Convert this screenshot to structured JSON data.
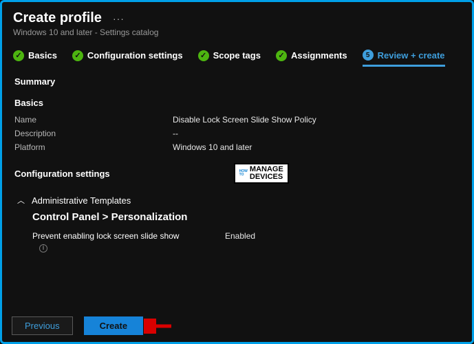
{
  "header": {
    "title": "Create profile",
    "subtitle": "Windows 10 and later - Settings catalog"
  },
  "steps": {
    "s1": "Basics",
    "s2": "Configuration settings",
    "s3": "Scope tags",
    "s4": "Assignments",
    "s5_num": "5",
    "s5": "Review + create"
  },
  "summary_label": "Summary",
  "basics": {
    "heading": "Basics",
    "name_key": "Name",
    "name_val": "Disable Lock Screen Slide Show Policy",
    "desc_key": "Description",
    "desc_val": "--",
    "platform_key": "Platform",
    "platform_val": "Windows 10 and later"
  },
  "config": {
    "heading": "Configuration settings",
    "watermark_top": "MANAGE",
    "watermark_bottom": "DEVICES",
    "watermark_how": "HOW",
    "watermark_to": "TO",
    "admin": "Administrative Templates",
    "path": "Control Panel > Personalization",
    "setting_label": "Prevent enabling lock screen slide show",
    "setting_val": "Enabled",
    "info_char": "i"
  },
  "footer": {
    "previous": "Previous",
    "create": "Create"
  }
}
